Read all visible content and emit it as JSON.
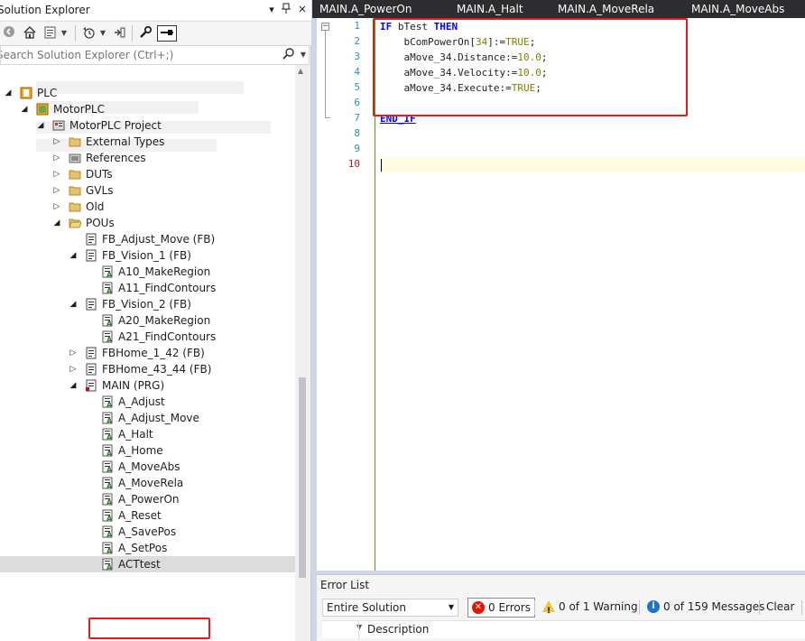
{
  "solution_explorer": {
    "title": "Solution Explorer",
    "pin_label": "▾",
    "pin2_label": "ㅍ",
    "close_label": "✕",
    "search_placeholder": "Search Solution Explorer (Ctrl+;)",
    "tree": [
      {
        "label": "PLC",
        "icon": "plc-icon",
        "expanded": true
      },
      {
        "label": "MotorPLC",
        "icon": "plc-project-icon",
        "expanded": true
      },
      {
        "label": "MotorPLC Project",
        "icon": "project-icon",
        "expanded": true
      },
      {
        "label": "External Types",
        "icon": "folder-icon",
        "expanded": false
      },
      {
        "label": "References",
        "icon": "references-icon",
        "expanded": false
      },
      {
        "label": "DUTs",
        "icon": "folder-icon",
        "expanded": false
      },
      {
        "label": "GVLs",
        "icon": "folder-icon",
        "expanded": false
      },
      {
        "label": "Old",
        "icon": "folder-icon",
        "expanded": false
      },
      {
        "label": "POUs",
        "icon": "folder-open-icon",
        "expanded": true
      },
      {
        "label": "FB_Adjust_Move (FB)",
        "icon": "fb-icon"
      },
      {
        "label": "FB_Vision_1 (FB)",
        "icon": "fb-icon",
        "expanded": true
      },
      {
        "label": "A10_MakeRegion",
        "icon": "action-icon"
      },
      {
        "label": "A11_FindContours",
        "icon": "action-icon"
      },
      {
        "label": "FB_Vision_2 (FB)",
        "icon": "fb-icon",
        "expanded": true
      },
      {
        "label": "A20_MakeRegion",
        "icon": "action-icon"
      },
      {
        "label": "A21_FindContours",
        "icon": "action-icon"
      },
      {
        "label": "FBHome_1_42 (FB)",
        "icon": "fb-icon",
        "expanded": false
      },
      {
        "label": "FBHome_43_44 (FB)",
        "icon": "fb-icon",
        "expanded": false
      },
      {
        "label": "MAIN (PRG)",
        "icon": "prg-icon",
        "expanded": true
      },
      {
        "label": "A_Adjust",
        "icon": "action-icon"
      },
      {
        "label": "A_Adjust_Move",
        "icon": "action-icon"
      },
      {
        "label": "A_Halt",
        "icon": "action-icon"
      },
      {
        "label": "A_Home",
        "icon": "action-icon"
      },
      {
        "label": "A_MoveAbs",
        "icon": "action-icon"
      },
      {
        "label": "A_MoveRela",
        "icon": "action-icon"
      },
      {
        "label": "A_PowerOn",
        "icon": "action-icon"
      },
      {
        "label": "A_Reset",
        "icon": "action-icon"
      },
      {
        "label": "A_SavePos",
        "icon": "action-icon"
      },
      {
        "label": "A_SetPos",
        "icon": "action-icon"
      },
      {
        "label": "ACTtest",
        "icon": "action-icon",
        "selected": true
      }
    ]
  },
  "editor": {
    "tabs": [
      "MAIN.A_PowerOn",
      "MAIN.A_Halt",
      "MAIN.A_MoveRela",
      "MAIN.A_MoveAbs"
    ],
    "line_numbers": [
      "1",
      "2",
      "3",
      "4",
      "5",
      "6",
      "7",
      "8",
      "9",
      "10"
    ],
    "code": {
      "l1_kw1": "IF",
      "l1_id": " bTest ",
      "l1_kw2": "THEN",
      "l2_id": "    bComPowerOn[",
      "l2_num": "34",
      "l2_rest": "]:=",
      "l2_val": "TRUE",
      "l2_end": ";",
      "l3_id": "    aMove_34.Distance:=",
      "l3_num": "10.0",
      "l3_end": ";",
      "l4_id": "    aMove_34.Velocity:=",
      "l4_num": "10.0",
      "l4_end": ";",
      "l5_id": "    aMove_34.Execute:=",
      "l5_val": "TRUE",
      "l5_end": ";",
      "l7_kw": "END_IF"
    },
    "fold_label": "−"
  },
  "error_list": {
    "title": "Error List",
    "scope": "Entire Solution",
    "errors": "0 Errors",
    "warnings": "0 of 1 Warning",
    "messages": "0 of 159 Messages",
    "clear": "Clear",
    "column_description": "Description"
  },
  "colors": {
    "highlight_box": "#e51b1b",
    "keyword": "#0000ff",
    "number": "#808000",
    "line_number": "#2b91af",
    "tab_bar": "#2d2d30"
  }
}
